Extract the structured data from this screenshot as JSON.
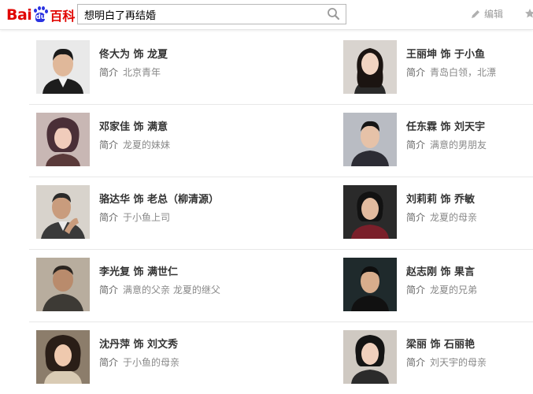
{
  "logo": {
    "text_bai": "Bai",
    "text_du": "du",
    "text_baike": "百科"
  },
  "search": {
    "value": "想明白了再结婚"
  },
  "toolbar": {
    "edit_label": "编辑"
  },
  "cast": [
    {
      "name": "佟大为 饰 龙夏",
      "intro_label": "简介",
      "intro": "北京青年",
      "icon": "actor-photo-1"
    },
    {
      "name": "王丽坤 饰 于小鱼",
      "intro_label": "简介",
      "intro": "青岛白领，北漂",
      "icon": "actor-photo-2"
    },
    {
      "name": "邓家佳 饰 满意",
      "intro_label": "简介",
      "intro": "龙夏的妹妹",
      "icon": "actor-photo-3"
    },
    {
      "name": "任东霖 饰 刘天宇",
      "intro_label": "简介",
      "intro": "满意的男朋友",
      "icon": "actor-photo-4"
    },
    {
      "name": "骆达华 饰 老总（柳清源）",
      "intro_label": "简介",
      "intro": "于小鱼上司",
      "icon": "actor-photo-5"
    },
    {
      "name": "刘莉莉 饰 乔敏",
      "intro_label": "简介",
      "intro": "龙夏的母亲",
      "icon": "actor-photo-6"
    },
    {
      "name": "李光复 饰 满世仁",
      "intro_label": "简介",
      "intro": "满意的父亲 龙夏的继父",
      "icon": "actor-photo-7"
    },
    {
      "name": "赵志刚 饰 果言",
      "intro_label": "简介",
      "intro": "龙夏的兄弟",
      "icon": "actor-photo-8"
    },
    {
      "name": "沈丹萍 饰 刘文秀",
      "intro_label": "简介",
      "intro": "于小鱼的母亲",
      "icon": "actor-photo-9"
    },
    {
      "name": "梁丽 饰 石丽艳",
      "intro_label": "简介",
      "intro": "刘天宇的母亲",
      "icon": "actor-photo-10"
    }
  ],
  "colors": {
    "brand_red": "#e10602",
    "brand_blue": "#2932e1"
  }
}
